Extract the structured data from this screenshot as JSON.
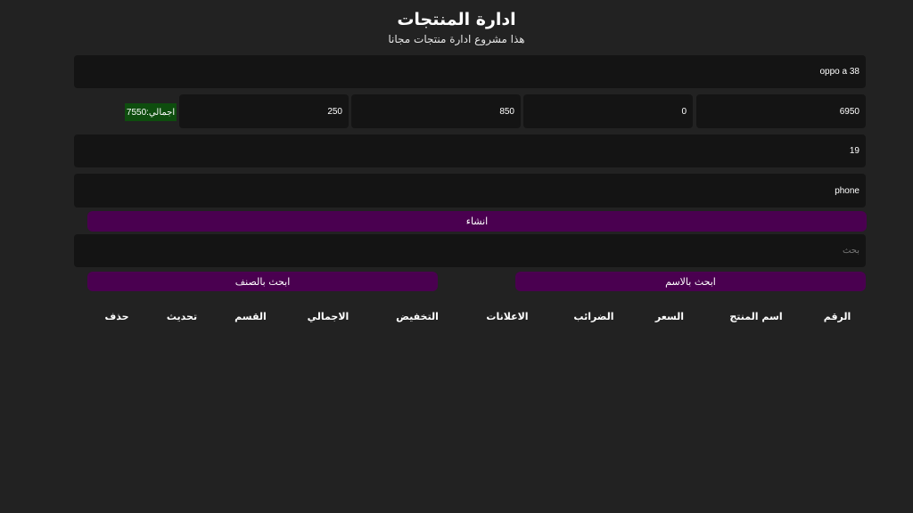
{
  "header": {
    "title": "ادارة المنتجات",
    "subtitle": "هذا مشروع ادارة منتجات مجانا"
  },
  "form": {
    "title_value": "oppo a 38",
    "price_value": "6950",
    "taxes_value": "0",
    "ads_value": "850",
    "discount_value": "250",
    "total_label": "اجمالي:7550",
    "count_value": "19",
    "category_value": "phone",
    "create_label": "انشاء"
  },
  "search": {
    "placeholder": "بحث",
    "by_title_label": "ابحث بالاسم",
    "by_category_label": "ابحث بالصنف"
  },
  "table": {
    "headers": [
      "الرقم",
      "اسم المنتج",
      "السعر",
      "الضرائب",
      "الاعلانات",
      "التخفيض",
      "الاجمالي",
      "القسم",
      "تحديث",
      "حذف"
    ]
  },
  "colors": {
    "background": "#222222",
    "input_bg": "#141414",
    "button_purple": "#4a0050",
    "total_green": "#0e4d0e"
  }
}
